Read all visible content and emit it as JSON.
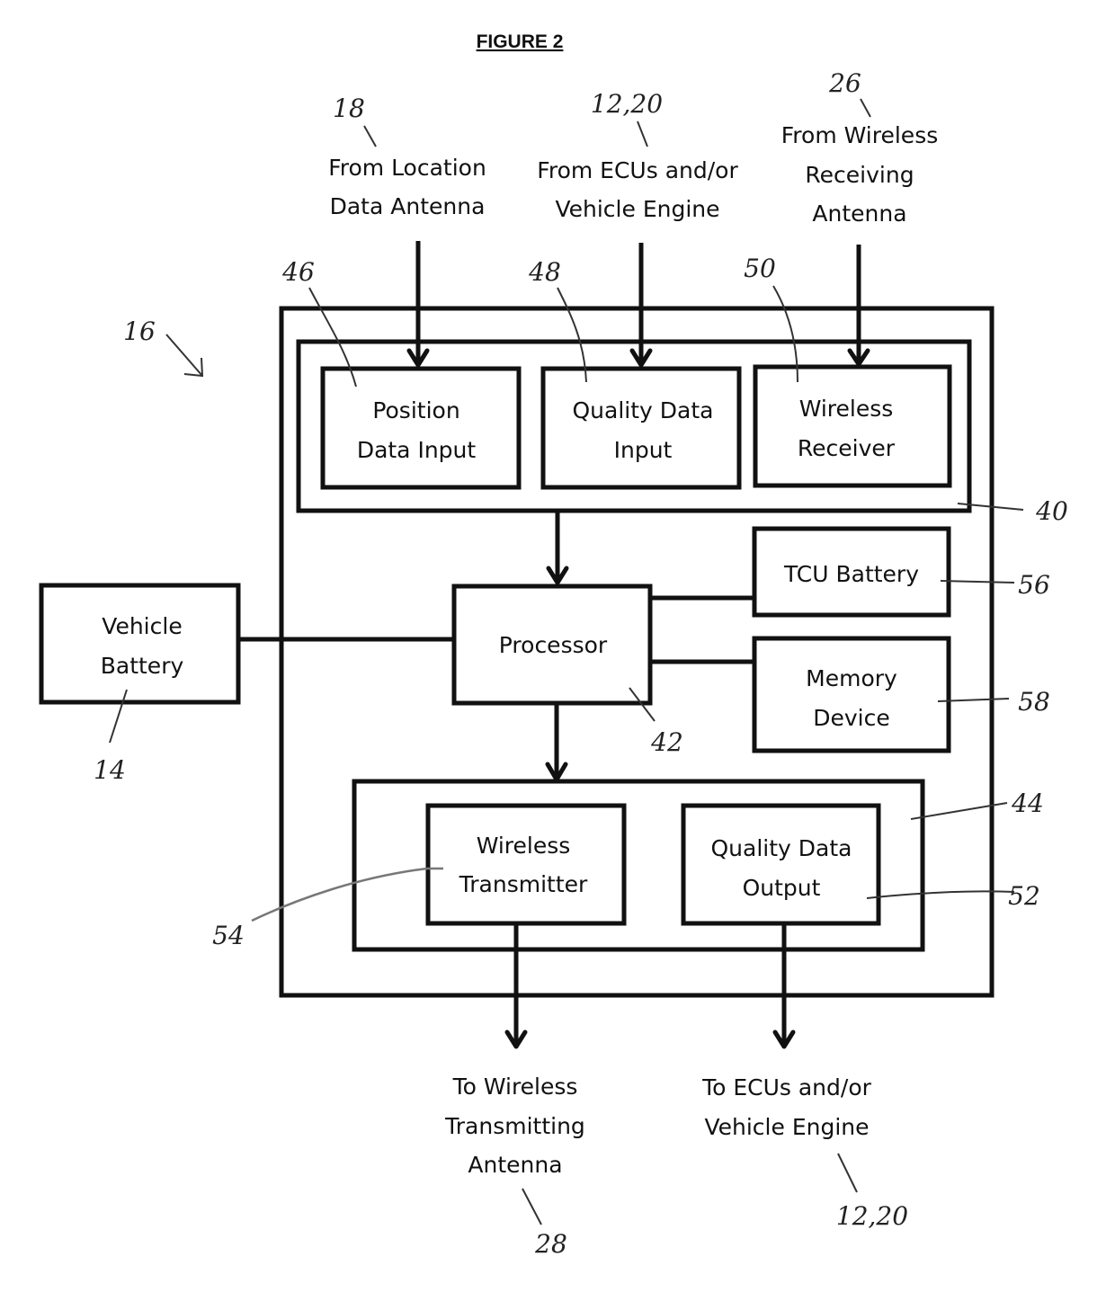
{
  "figure": {
    "title": "FIGURE 2",
    "system_ref": "16"
  },
  "inputs": {
    "location_antenna": {
      "lines": [
        "From Location",
        "Data Antenna"
      ],
      "ref": "18"
    },
    "ecus_in": {
      "lines": [
        "From ECUs and/or",
        "Vehicle Engine"
      ],
      "ref": "12,20"
    },
    "wireless_rx_antenna": {
      "lines": [
        "From Wireless",
        "Receiving",
        "Antenna"
      ],
      "ref": "26"
    }
  },
  "input_module": {
    "ref": "40",
    "blocks": [
      {
        "lines": [
          "Position",
          "Data Input"
        ],
        "ref": "46"
      },
      {
        "lines": [
          "Quality Data",
          "Input"
        ],
        "ref": "48"
      },
      {
        "lines": [
          "Wireless",
          "Receiver"
        ],
        "ref": "50"
      }
    ]
  },
  "processor": {
    "lines": [
      "Processor"
    ],
    "ref": "42"
  },
  "tcu_battery": {
    "lines": [
      "TCU Battery"
    ],
    "ref": "56"
  },
  "memory": {
    "lines": [
      "Memory",
      "Device"
    ],
    "ref": "58"
  },
  "vehicle_battery": {
    "lines": [
      "Vehicle",
      "Battery"
    ],
    "ref": "14"
  },
  "output_module": {
    "ref": "44",
    "blocks": [
      {
        "lines": [
          "Wireless",
          "Transmitter"
        ],
        "ref": "54"
      },
      {
        "lines": [
          "Quality Data",
          "Output"
        ],
        "ref": "52"
      }
    ]
  },
  "outputs": {
    "wireless_tx_antenna": {
      "lines": [
        "To Wireless",
        "Transmitting",
        "Antenna"
      ],
      "ref": "28"
    },
    "ecus_out": {
      "lines": [
        "To ECUs and/or",
        "Vehicle Engine"
      ],
      "ref": "12,20"
    }
  }
}
